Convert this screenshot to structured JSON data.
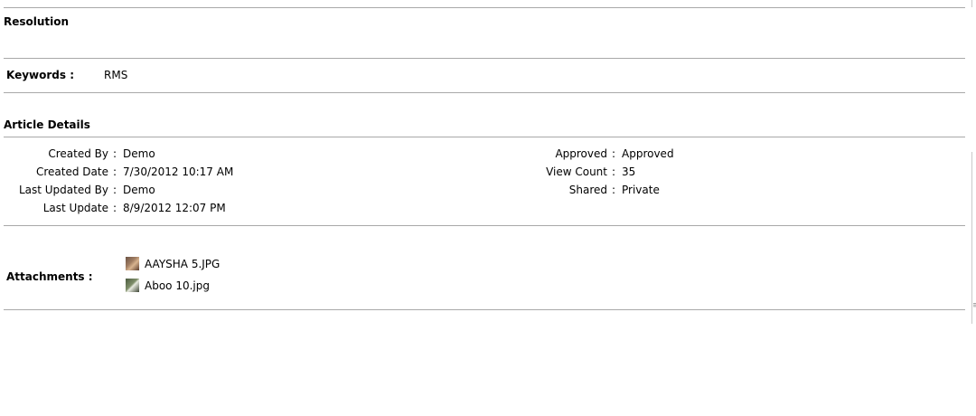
{
  "resolution": {
    "title": "Resolution"
  },
  "keywords": {
    "label": "Keywords :",
    "value": "RMS"
  },
  "article_details": {
    "title": "Article Details",
    "left": [
      {
        "label": "Created By",
        "value": "Demo"
      },
      {
        "label": "Created Date",
        "value": "7/30/2012 10:17 AM"
      },
      {
        "label": "Last Updated By",
        "value": "Demo"
      },
      {
        "label": "Last Update",
        "value": "8/9/2012 12:07 PM"
      }
    ],
    "right": [
      {
        "label": "Approved",
        "value": "Approved"
      },
      {
        "label": "View Count",
        "value": "35"
      },
      {
        "label": "Shared",
        "value": "Private"
      }
    ],
    "separator": ":"
  },
  "attachments": {
    "label": "Attachments :",
    "items": [
      {
        "name": "AAYSHA 5.JPG",
        "icon": "image-thumbnail-icon"
      },
      {
        "name": "Aboo 10.jpg",
        "icon": "image-thumbnail-icon"
      }
    ]
  },
  "colors": {
    "divider": "#a9a9a9",
    "text": "#000000",
    "background": "#ffffff"
  }
}
